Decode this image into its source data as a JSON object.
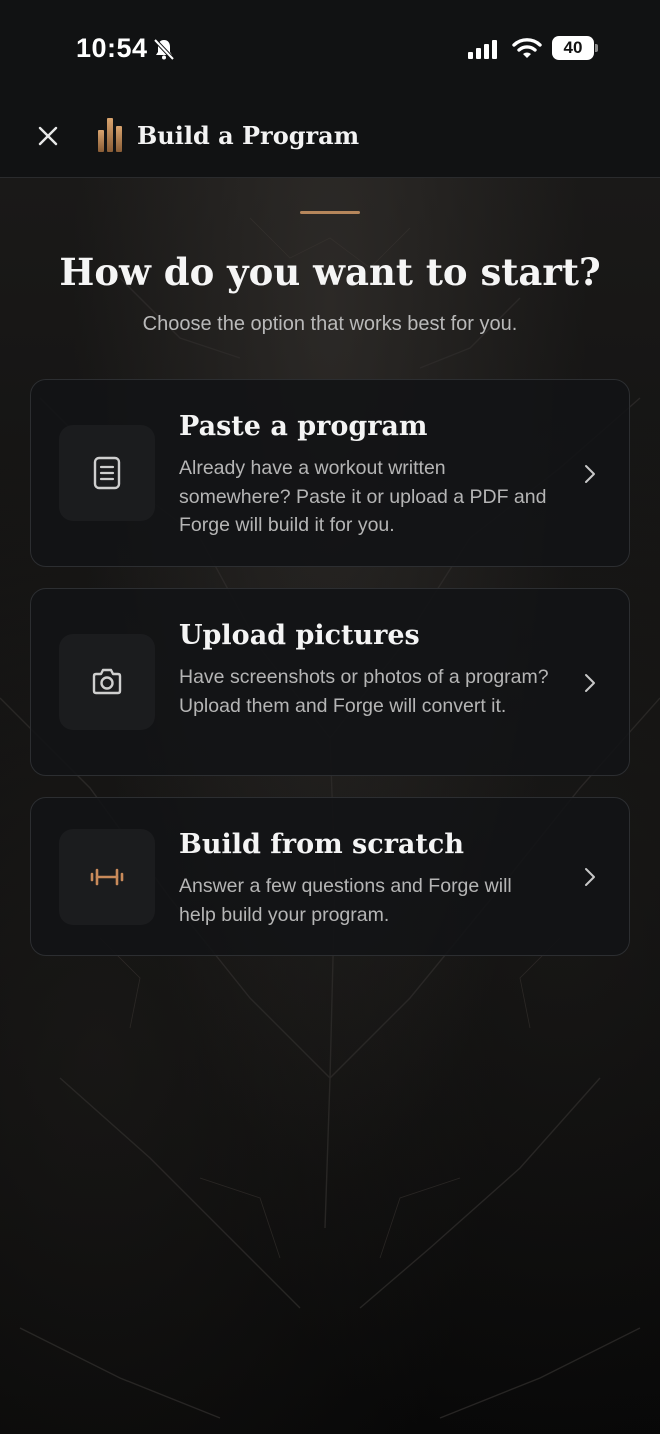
{
  "status_bar": {
    "time": "10:54",
    "battery": "40"
  },
  "header": {
    "title": "Build a Program"
  },
  "main": {
    "title": "How do you want to start?",
    "subtitle": "Choose the option that works best for you.",
    "options": [
      {
        "title": "Paste a program",
        "description": "Already have a workout written somewhere? Paste it or upload a PDF and Forge will build it for you.",
        "icon": "document-icon"
      },
      {
        "title": "Upload pictures",
        "description": "Have screenshots or photos of a program? Upload them and Forge will convert it.",
        "icon": "camera-icon"
      },
      {
        "title": "Build from scratch",
        "description": "Answer a few questions and Forge will help build your program.",
        "icon": "dumbbell-icon"
      }
    ]
  },
  "colors": {
    "accent": "#b5865b",
    "background": "#0b0b0c",
    "card": "#121416"
  }
}
